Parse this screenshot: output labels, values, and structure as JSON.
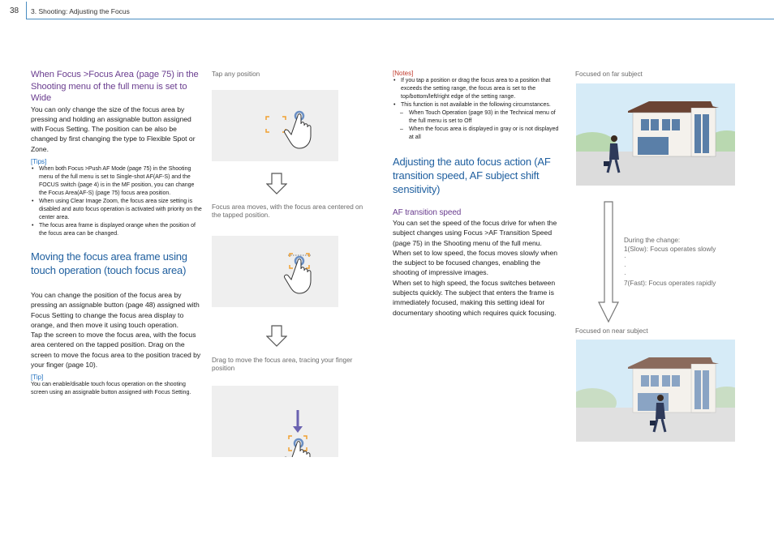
{
  "header": {
    "page_number": "38",
    "breadcrumb": "3. Shooting: Adjusting the Focus"
  },
  "col1": {
    "subheading": "When Focus >Focus Area (page 75) in the Shooting menu of the full menu is set to Wide",
    "paragraph1": "You can only change the size of the focus area by pressing and holding an assignable button assigned with Focus Setting. The position can be also be changed by first changing the type to Flexible Spot or Zone.",
    "tips_label": "[Tips]",
    "tips": [
      "When both Focus >Push AF Mode (page 75) in the Shooting menu of the full menu is set to Single-shot AF(AF-S) and the FOCUS switch (page 4) is in the MF position, you can change the Focus Area(AF-S) (page 75) focus area position.",
      "When using Clear Image Zoom, the focus area size setting is disabled and auto focus operation is activated with priority on the center area.",
      "The focus area frame is displayed orange when the position of the focus area can be changed."
    ],
    "section_heading": "Moving the focus area frame using touch operation (touch focus area)",
    "paragraph2": "You can change the position of the focus area by pressing an assignable button (page 48) assigned with Focus Setting to change the focus area display to orange, and then move it using touch operation.",
    "paragraph3": "Tap the screen to move the focus area, with the focus area centered on the tapped position. Drag on the screen to move the focus area to the position traced by your finger (page 10).",
    "tip_label": "[Tip]",
    "tip_text": "You can enable/disable touch focus operation on the shooting screen using an assignable button assigned with Focus Setting."
  },
  "col2": {
    "caption1": "Tap any position",
    "caption2": "Focus area moves, with the focus area centered on the tapped position.",
    "caption3": "Drag to move the focus area, tracing your finger position"
  },
  "col3": {
    "notes_label": "[Notes]",
    "notes": [
      "If you tap a position or drag the focus area to a position that exceeds the setting range, the focus area is set to the top/bottom/left/right edge of the setting range.",
      "This function is not available in the following circumstances."
    ],
    "note_sub": [
      "When Touch Operation (page 93) in the Technical menu of the full menu is set to Off",
      "When the focus area is displayed in gray or is not displayed at all"
    ],
    "section_heading": "Adjusting the auto focus action (AF transition speed, AF subject shift sensitivity)",
    "subheading": "AF transition speed",
    "paragraph1": "You can set the speed of the focus drive for when the subject changes using Focus >AF Transition Speed (page 75) in the Shooting menu of the full menu.",
    "paragraph2": "When set to low speed, the focus moves slowly when the subject to be focused changes, enabling the shooting of impressive images.",
    "paragraph3": "When set to high speed, the focus switches between subjects quickly. The subject that enters the frame is immediately focused, making this setting ideal for documentary shooting which requires quick focusing."
  },
  "col4": {
    "caption_far": "Focused on far subject",
    "during": "During the change:",
    "slow": "1(Slow): Focus operates slowly",
    "dots": [
      "·",
      "·",
      "·"
    ],
    "fast": "7(Fast): Focus operates rapidly",
    "caption_near": "Focused on near subject"
  },
  "colors": {
    "accent_blue": "#1f5f9f",
    "purple": "#6a3d8f",
    "focus_orange": "#f0a030",
    "notes_red": "#c0392b"
  }
}
